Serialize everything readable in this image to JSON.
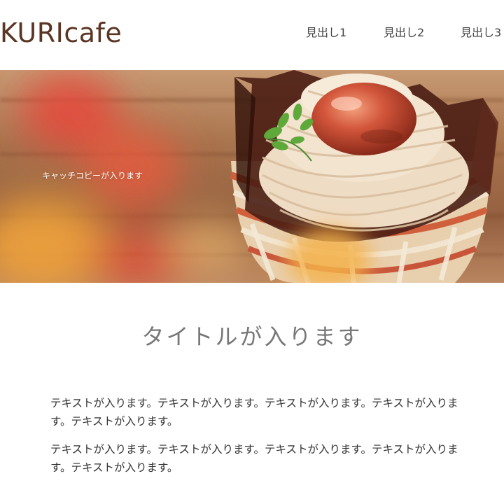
{
  "header": {
    "logo": "KURIcafe",
    "nav": [
      "見出し1",
      "見出し2",
      "見出し3"
    ]
  },
  "hero": {
    "catch_copy": "キャッチコピーが入ります"
  },
  "main": {
    "title": "タイトルが入ります",
    "paragraphs": [
      "テキストが入ります。テキストが入ります。テキストが入ります。テキストが入ります。テキストが入ります。",
      "テキストが入ります。テキストが入ります。テキストが入ります。テキストが入ります。テキストが入ります。"
    ]
  },
  "colors": {
    "logo": "#5b3523",
    "title": "#777777",
    "text": "#333333"
  }
}
